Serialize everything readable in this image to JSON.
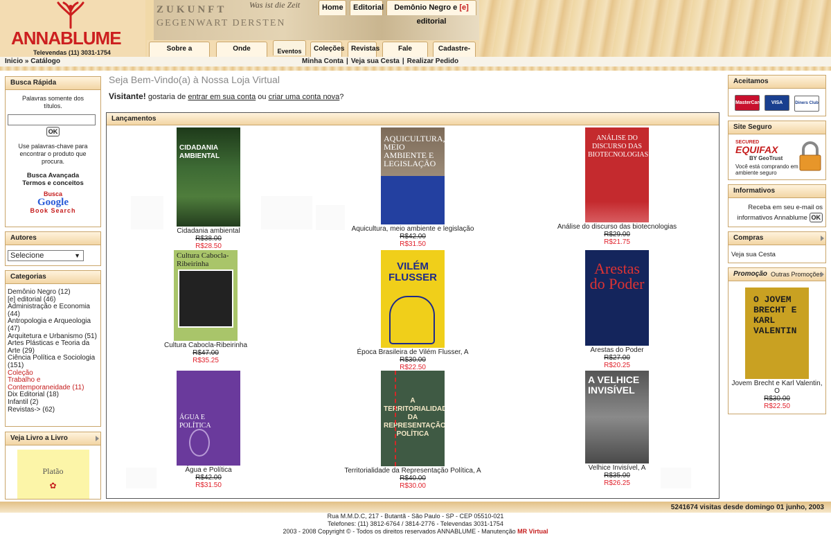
{
  "brand": {
    "name": "ANNABLUME",
    "phone": "Televendas (11) 3031-1754"
  },
  "collage": {
    "line1": "ZUKUNFT",
    "line2": "GEGENWART DERSTEN",
    "line3": "Was ist die Zeit"
  },
  "top_nav": [
    {
      "label": "Home"
    },
    {
      "label": "Editorial"
    },
    {
      "label_pre": "Demônio Negro e ",
      "label_mid": "[e]",
      "label_post": " editorial"
    }
  ],
  "sub_nav": [
    "Sobre a Distribuição",
    "Onde Encontrar",
    "Eventos",
    "Coleções",
    "Revistas",
    "Fale Conosco",
    "Cadastre-se"
  ],
  "breadcrumb": "Inicio » Catálogo",
  "account_links": [
    "Minha Conta",
    "Veja sua Cesta",
    "Realizar Pedido"
  ],
  "quick_search": {
    "title": "Busca Rápida",
    "hint": "Palavras somente dos títulos.",
    "placeholder": "",
    "go": "OK",
    "tip": "Use palavras-chave para encontrar o produto que procura.",
    "advanced": "Busca Avançada",
    "terms": "Termos e conceitos",
    "google_top": "Busca",
    "google": "Google",
    "google_bottom": "Book Search"
  },
  "authors": {
    "title": "Autores",
    "selected": "Selecione"
  },
  "categories": {
    "title": "Categorias",
    "items": [
      "Demônio Negro (12)",
      "[e] editorial (46)",
      "Administração e Economia (44)",
      "Antropologia e Arqueologia (47)",
      "Arquitetura e Urbanismo (51)",
      "Artes Plásticas e Teoria da Arte (29)",
      "Ciência Política e Sociologia (151)",
      "Coleção",
      "Trabalho e Contemporaneidade (11)",
      "Dix Editorial (18)",
      "Infantil (2)",
      "Revistas-> (62)"
    ]
  },
  "book_viewer": {
    "title": "Veja Livro a Livro",
    "cover_text": "Platão"
  },
  "page": {
    "title": "Seja Bem-Vindo(a) à Nossa Loja Virtual",
    "visitor": "Visitante!",
    "welcome_pre": "gostaria de",
    "login": "entrar em sua conta",
    "or": "ou",
    "create": "criar uma conta nova",
    "end": "?"
  },
  "releases": {
    "title": "Lançamentos",
    "books": [
      {
        "name": "Cidadania ambiental",
        "old": "R$38.00",
        "price": "R$28.50",
        "cover": "CIDADANIA AMBIENTAL",
        "color": "#2f5a2a"
      },
      {
        "name": "Aquicultura, meio ambiente e legislação",
        "old": "R$42.00",
        "price": "R$31.50",
        "cover": "AQUICULTURA, MEIO AMBIENTE E LEGISLAÇÃO",
        "color": "#2340a0"
      },
      {
        "name": "Análise do discurso das biotecnologias",
        "old": "R$29.00",
        "price": "R$21.75",
        "cover": "ANÁLISE DO DISCURSO DAS BIOTECNOLOGIAS",
        "color": "#c42a2e"
      },
      {
        "name": "Cultura Cabocla-Ribeirinha",
        "old": "R$47.00",
        "price": "R$35.25",
        "cover": "Cultura Cabocla-Ribeirinha",
        "color": "#a9c56a"
      },
      {
        "name": "Época Brasileira de Vilém Flusser, A",
        "old": "R$30.00",
        "price": "R$22.50",
        "cover": "VILÉM FLUSSER",
        "color": "#f0cf1a"
      },
      {
        "name": "Arestas do Poder",
        "old": "R$27.00",
        "price": "R$20.25",
        "cover": "Arestas do Poder",
        "color": "#14255c"
      },
      {
        "name": "Água e Política",
        "old": "R$42.00",
        "price": "R$31.50",
        "cover": "ÁGUA E POLÍTICA",
        "color": "#6a3a9c"
      },
      {
        "name": "Territorialidade da Representação Política, A",
        "old": "R$40.00",
        "price": "R$30.00",
        "cover": "A TERRITORIALIDADE DA REPRESENTAÇÃO POLÍTICA",
        "color": "#3f5a44"
      },
      {
        "name": "Velhice Invisível, A",
        "old": "R$35.00",
        "price": "R$26.25",
        "cover": "A VELHICE INVISÍVEL",
        "color": "#6d6d6d"
      }
    ]
  },
  "accepted": {
    "title": "Aceitamos",
    "cards": [
      "MasterCard",
      "VISA",
      "Diners Club"
    ]
  },
  "secure": {
    "title": "Site Seguro",
    "secured": "SECURED",
    "brand": "EQUIFAX",
    "by": "BY GeoTrust",
    "text": "Você está comprando em ambiente seguro"
  },
  "newsletter": {
    "title": "Informativos",
    "text": "Receba em seu e-mail os informativos Annablume",
    "go": "OK"
  },
  "cart": {
    "title": "Compras",
    "link": "Veja sua Cesta"
  },
  "promo": {
    "title": "Promoção",
    "more": "Outras Promoções",
    "cover": "O JOVEM BRECHT E KARL VALENTIN",
    "name": "Jovem Brecht e Karl Valentin, O",
    "old": "R$30.00",
    "price": "R$22.50"
  },
  "footer": {
    "visits": "5241674 visitas desde domingo 01 junho, 2003",
    "address": "Rua M.M.D.C, 217 - Butantã - São Paulo - SP - CEP 05510-021",
    "phones": "Telefones: (11) 3812-6764 / 3814-2776 - Televendas 3031-1754",
    "copyright": "2003 - 2008 Copyright © - Todos os direitos reservados ANNABLUME - Manutenção",
    "maint": "MR Virtual"
  }
}
